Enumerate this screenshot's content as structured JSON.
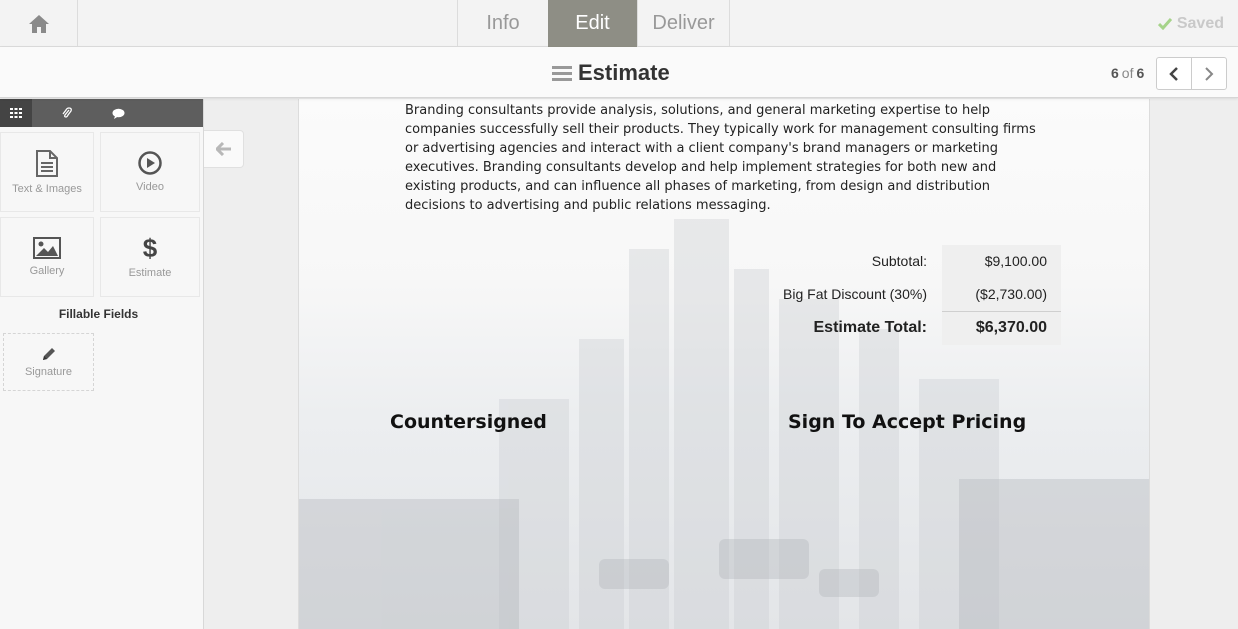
{
  "nav": {
    "tabs": [
      "Info",
      "Edit",
      "Deliver"
    ],
    "active_tab": "Edit",
    "saved_label": "Saved"
  },
  "titlebar": {
    "title": "Estimate",
    "page_current": "6",
    "page_of": "of",
    "page_total": "6"
  },
  "sidebar": {
    "tools": [
      {
        "label": "Text & Images",
        "icon": "document-icon"
      },
      {
        "label": "Video",
        "icon": "play-icon"
      },
      {
        "label": "Gallery",
        "icon": "image-icon"
      },
      {
        "label": "Estimate",
        "icon": "dollar-icon"
      }
    ],
    "fillable_title": "Fillable Fields",
    "signature_label": "Signature"
  },
  "document": {
    "paragraph": "Branding consultants provide analysis, solutions, and general marketing expertise to help companies successfully sell their products. They typically work for management consulting firms or advertising agencies and interact with a client company's brand managers or marketing executives. Branding consultants develop and help implement strategies for both new and existing products, and can influence all phases of marketing, from design and distribution decisions to advertising and public relations messaging.",
    "subtotal_label": "Subtotal:",
    "subtotal_value": "$9,100.00",
    "discount_label": "Big Fat Discount (30%)",
    "discount_value": "($2,730.00)",
    "total_label": "Estimate Total:",
    "total_value": "$6,370.00",
    "countersigned": "Countersigned",
    "accept": "Sign To Accept Pricing"
  },
  "colors": {
    "active_tab_bg": "#8e8e85",
    "sidebar_tab_bg": "#5e5e5e",
    "saved_check": "#a6d38a"
  }
}
